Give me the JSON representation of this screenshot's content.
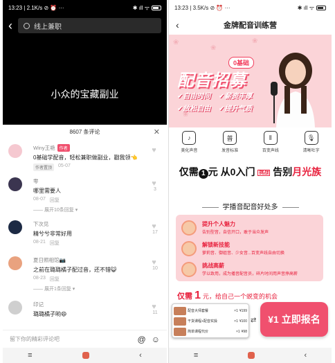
{
  "left": {
    "status": {
      "time": "13:23",
      "speed": "2.1K/s",
      "extra": "⊘ ⏰ ···",
      "right": "✱ ıll ᯤ"
    },
    "search_placeholder": "线上兼职",
    "video_caption": "小众的宝藏副业",
    "comments_title": "8607 条评论",
    "comments": [
      {
        "name": "Winy王艳",
        "badge": "作者",
        "text": "0基础学配音，轻松兼职做副业，戳我领👈",
        "tag": "作者置顶",
        "date": "05-07",
        "reply": "",
        "likes": "",
        "expand": "",
        "avatar_color": "#f5c8d0"
      },
      {
        "name": "零",
        "badge": "",
        "text": "哪里需要人",
        "tag": "",
        "date": "08-07",
        "reply": "回复",
        "likes": "3",
        "expand": "展开10条回复",
        "avatar_color": "#3b3550"
      },
      {
        "name": "下次见",
        "badge": "",
        "text": "精兮兮非常好用",
        "tag": "",
        "date": "08-21",
        "reply": "回复",
        "likes": "17",
        "expand": "",
        "avatar_color": "#1c2a44"
      },
      {
        "name": "夏日照相馆📷",
        "badge": "",
        "text": "之前在璐璐橘子配过音，还不错😺",
        "tag": "",
        "date": "08-23",
        "reply": "回复",
        "likes": "10",
        "expand": "展开1条回复",
        "avatar_color": "#e9a27f"
      },
      {
        "name": "印记",
        "badge": "",
        "text": "璐璐橘子哟😄",
        "tag": "",
        "date": "",
        "reply": "",
        "likes": "11",
        "expand": "",
        "avatar_color": "#cfcfcf"
      }
    ],
    "input_placeholder": "留下你的精彩评论吧",
    "at_icon": "@",
    "emoji_icon": "☺"
  },
  "right": {
    "status": {
      "time": "13:23",
      "speed": "3.5K/s",
      "extra": "⊘ ⏰ ···",
      "right": "✱ ıll ᯤ"
    },
    "title": "金牌配音训练营",
    "zero_badge": "0基础",
    "banner_title": "配音招募",
    "features": [
      "✔自由时间",
      "✔薪资丰厚",
      "✔放松自由",
      "✔提升气质"
    ],
    "icons": [
      {
        "label": "美化声音",
        "glyph": "♪"
      },
      {
        "label": "发音标准",
        "glyph": "普"
      },
      {
        "label": "百变声线",
        "glyph": "⦀"
      },
      {
        "label": "清晰吐字",
        "glyph": "🎙"
      }
    ],
    "headline": {
      "pre": "仅需",
      "one": "1",
      "yuan": "元 从0入门",
      "tiao": "挑战",
      "post": "告别",
      "red": "月光族"
    },
    "section_title": "学播音配音好处多",
    "benefits": [
      {
        "title": "提升个人魅力",
        "desc": "告别型音，自信开口，敢于当众发声"
      },
      {
        "title": "解锁新技能",
        "desc": "萝莉音、御姐音、少女音...百变声线自由切换"
      },
      {
        "title": "挑战高薪",
        "desc": "学以致用，成为播音配音员，碎片时间用声音挣高薪"
      }
    ],
    "promo": {
      "pre": "仅需",
      "num": "1",
      "post": "元，给自己一个蜕变的机会"
    },
    "orders": [
      {
        "name": "配音大师套餐",
        "count": "×1",
        "price": "¥199"
      },
      {
        "name": "干货课程+配音实操",
        "count": "×1",
        "price": "¥100"
      },
      {
        "name": "简单课程代价",
        "count": "×1",
        "price": "¥98"
      }
    ],
    "cta": "¥1 立即报名"
  },
  "nav": {
    "menu": "≡",
    "back": "‹"
  }
}
